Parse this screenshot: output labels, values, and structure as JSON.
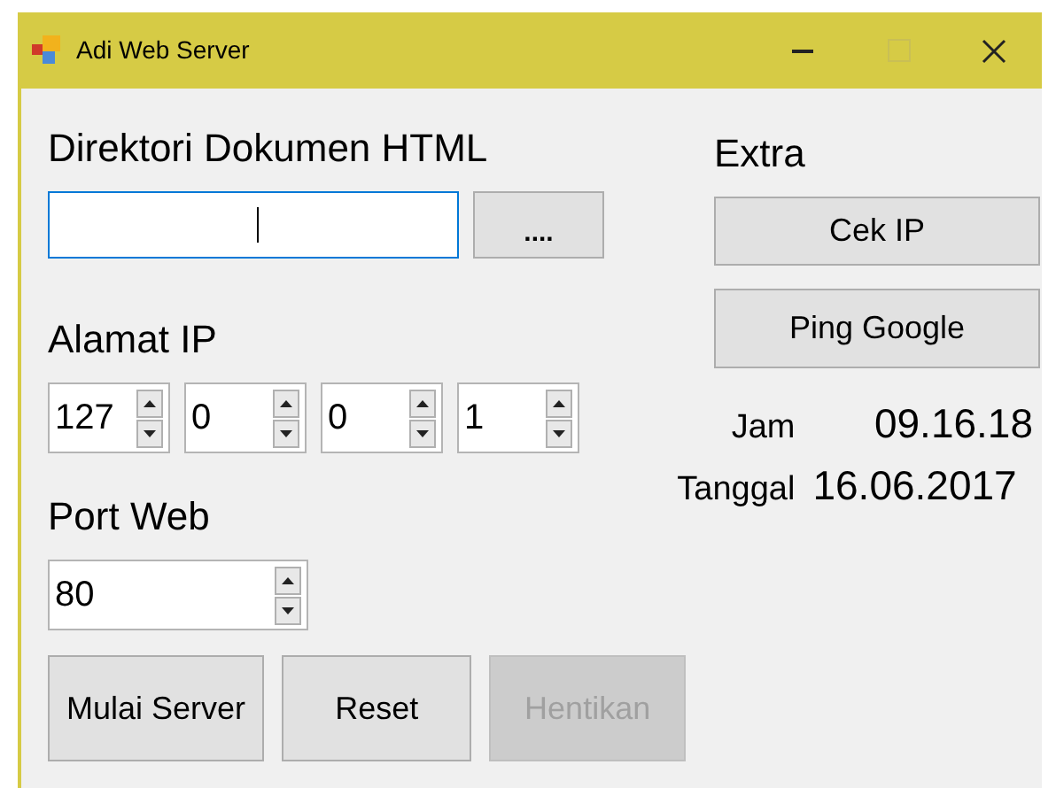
{
  "window": {
    "title": "Adi Web Server",
    "controls": [
      {
        "kind": "minimize",
        "disabled": false
      },
      {
        "kind": "maximize",
        "disabled": true
      },
      {
        "kind": "close",
        "disabled": false
      }
    ]
  },
  "document_dir": {
    "label": "Direktori Dokumen HTML",
    "focused": true,
    "browse_button": "...."
  },
  "ip_address": {
    "label": "Alamat IP",
    "octets": [
      "127",
      "0",
      "0",
      "1"
    ]
  },
  "port": {
    "label": "Port Web",
    "value": "80"
  },
  "actions": [
    {
      "label": "Mulai Server",
      "disabled": false
    },
    {
      "label": "Reset",
      "disabled": false
    },
    {
      "label": "Hentikan",
      "disabled": true
    }
  ],
  "extra": {
    "title": "Extra",
    "buttons": [
      "Cek IP",
      "Ping Google"
    ],
    "time": {
      "label": "Jam",
      "value": "09.16.18"
    },
    "date": {
      "label": "Tanggal",
      "value": "16.06.2017"
    }
  }
}
